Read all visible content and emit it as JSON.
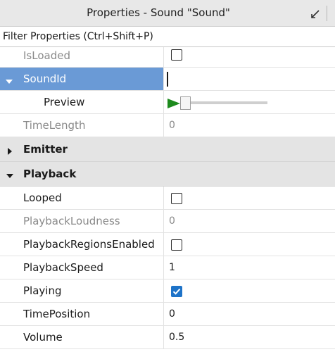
{
  "window": {
    "title": "Properties - Sound \"Sound\""
  },
  "filter": {
    "placeholder": "Filter Properties (Ctrl+Shift+P)"
  },
  "properties": {
    "is_loaded": {
      "label": "IsLoaded",
      "checked": false
    },
    "sound_id": {
      "label": "SoundId",
      "value": ""
    },
    "preview": {
      "label": "Preview"
    },
    "time_length": {
      "label": "TimeLength",
      "value": "0"
    },
    "looped": {
      "label": "Looped",
      "checked": false
    },
    "playback_loudness": {
      "label": "PlaybackLoudness",
      "value": "0"
    },
    "playback_regions_enabled": {
      "label": "PlaybackRegionsEnabled",
      "checked": false
    },
    "playback_speed": {
      "label": "PlaybackSpeed",
      "value": "1"
    },
    "playing": {
      "label": "Playing",
      "checked": true
    },
    "time_position": {
      "label": "TimePosition",
      "value": "0"
    },
    "volume": {
      "label": "Volume",
      "value": "0.5"
    }
  },
  "categories": {
    "emitter": {
      "label": "Emitter",
      "expanded": false
    },
    "playback": {
      "label": "Playback",
      "expanded": true
    }
  },
  "colors": {
    "selection": "#6a9ad6",
    "checkbox_checked": "#1e73c8",
    "play_icon": "#1d8a1d",
    "category_bg": "#e4e4e4"
  },
  "icons": {
    "undock": "undock-icon",
    "expand": "triangle-right-icon",
    "collapse": "triangle-down-icon",
    "play": "play-icon",
    "check": "checkmark-icon"
  }
}
